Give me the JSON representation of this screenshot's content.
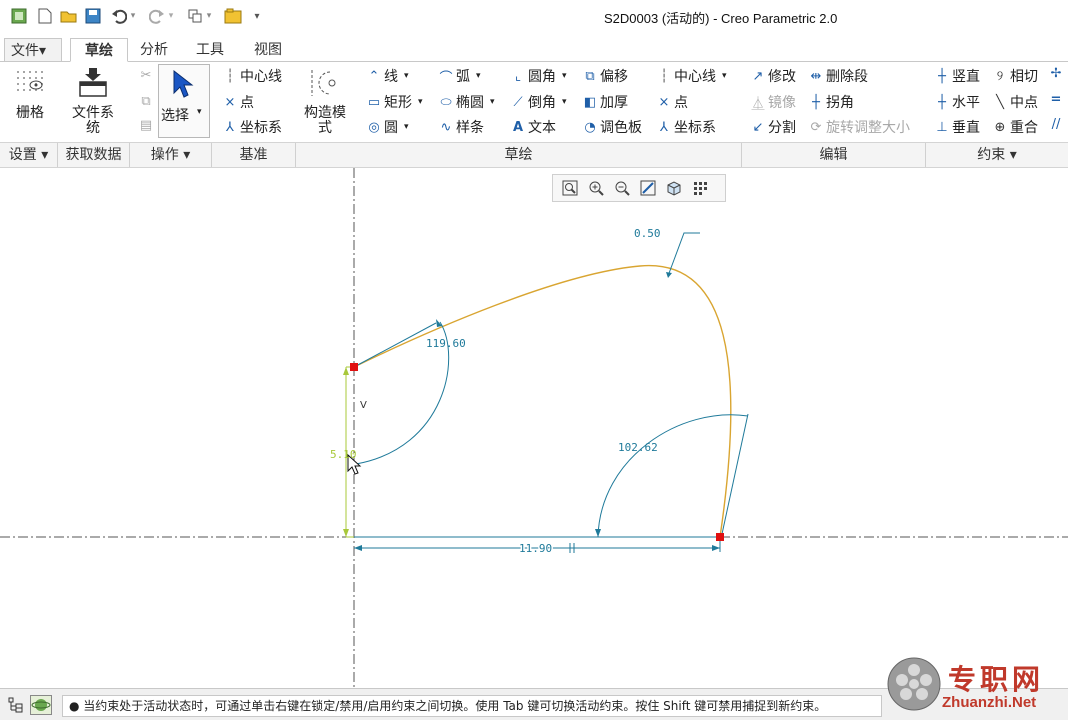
{
  "window": {
    "title": "S2D0003 (活动的) - Creo Parametric 2.0"
  },
  "tabs": [
    {
      "label": "文件▾"
    },
    {
      "label": "草绘"
    },
    {
      "label": "分析"
    },
    {
      "label": "工具"
    },
    {
      "label": "视图"
    }
  ],
  "ribbon": {
    "grid": "栅格",
    "file_system": "文件系统",
    "select": "选择",
    "construct_mode": "构造模式",
    "datum": {
      "centerline": "中心线",
      "point": "点",
      "coord": "坐标系"
    },
    "sketch": {
      "line": "线",
      "rect": "矩形",
      "circle": "圆",
      "arc": "弧",
      "ellipse": "椭圆",
      "spline": "样条",
      "fillet": "圆角",
      "chamfer": "倒角",
      "text": "文本",
      "offset": "偏移",
      "thicken": "加厚",
      "palette": "调色板",
      "centerline": "中心线",
      "point": "点",
      "coord": "坐标系"
    },
    "edit": {
      "modify": "修改",
      "delete_seg": "删除段",
      "mirror": "镜像",
      "corner": "拐角",
      "divide": "分割",
      "rotate_resize": "旋转调整大小"
    },
    "constrain": {
      "vertical": "竖直",
      "tangent": "相切",
      "horizontal": "水平",
      "midpoint": "中点",
      "perpendicular": "垂直",
      "coincident": "重合"
    }
  },
  "groups": {
    "settings": "设置 ▾",
    "get_data": "获取数据",
    "operations": "操作 ▾",
    "datum": "基准",
    "sketch": "草绘",
    "edit": "编辑",
    "constrain": "约束 ▾"
  },
  "dimensions": {
    "d1": "0.50",
    "d2": "119.60",
    "d3": "102.62",
    "d4": "11.90",
    "d5": "5.10",
    "constraint_v": "V"
  },
  "status": {
    "message": "● 当约束处于活动状态时，可通过单击右键在锁定/禁用/启用约束之间切换。使用 Tab 键可切换活动约束。按住 Shift 键可禁用捕捉到新约束。"
  },
  "watermark": {
    "text": "专职网",
    "url": "Zhuanzhi.Net"
  },
  "colors": {
    "curve": "#d9a531",
    "dimension": "#1f7a9a",
    "vertical_dim": "#a8c83a",
    "point": "#e01010"
  }
}
